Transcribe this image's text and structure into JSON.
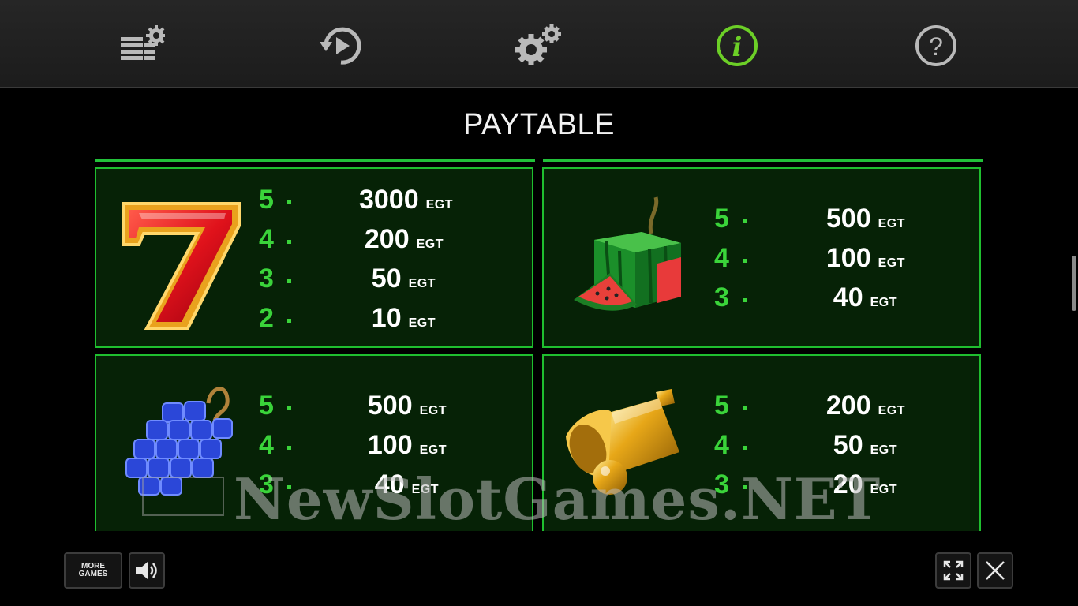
{
  "toolbar": {
    "icons": [
      "paytable-settings-icon",
      "autoplay-icon",
      "settings-icon",
      "info-icon",
      "help-icon"
    ],
    "active": "info-icon",
    "active_color": "#6ccf27"
  },
  "title": "PAYTABLE",
  "currency": "EGT",
  "cards": [
    {
      "symbol": "seven-symbol",
      "rows": [
        {
          "count": "5",
          "value": "3000"
        },
        {
          "count": "4",
          "value": "200"
        },
        {
          "count": "3",
          "value": "50"
        },
        {
          "count": "2",
          "value": "10"
        }
      ]
    },
    {
      "symbol": "watermelon-symbol",
      "rows": [
        {
          "count": "5",
          "value": "500"
        },
        {
          "count": "4",
          "value": "100"
        },
        {
          "count": "3",
          "value": "40"
        }
      ]
    },
    {
      "symbol": "grapes-symbol",
      "rows": [
        {
          "count": "5",
          "value": "500"
        },
        {
          "count": "4",
          "value": "100"
        },
        {
          "count": "3",
          "value": "40"
        }
      ]
    },
    {
      "symbol": "bell-symbol",
      "rows": [
        {
          "count": "5",
          "value": "200"
        },
        {
          "count": "4",
          "value": "50"
        },
        {
          "count": "3",
          "value": "20"
        }
      ]
    }
  ],
  "watermark": "NewSlotGames.NET",
  "bottom": {
    "more_games_line1": "MORE",
    "more_games_line2": "GAMES"
  },
  "colors": {
    "card_border": "#1fbf2f",
    "card_bg": "#062206",
    "count": "#3ad43a"
  }
}
